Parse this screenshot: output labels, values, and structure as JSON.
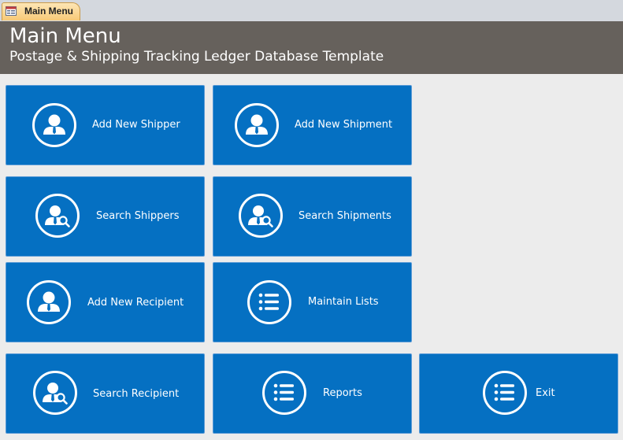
{
  "tab": {
    "label": "Main Menu",
    "icon": "form-icon"
  },
  "header": {
    "title": "Main Menu",
    "subtitle": "Postage & Shipping Tracking Ledger Database Template"
  },
  "buttons": {
    "add_new_shipper": {
      "label": "Add New Shipper",
      "icon": "user-icon"
    },
    "add_new_shipment": {
      "label": "Add New Shipment",
      "icon": "user-icon"
    },
    "search_shippers": {
      "label": "Search Shippers",
      "icon": "user-search-icon"
    },
    "search_shipments": {
      "label": "Search Shipments",
      "icon": "user-search-icon"
    },
    "add_new_recipient": {
      "label": "Add New Recipient",
      "icon": "user-icon"
    },
    "maintain_lists": {
      "label": "Maintain Lists",
      "icon": "list-icon"
    },
    "search_recipient": {
      "label": "Search Recipient",
      "icon": "user-search-icon"
    },
    "reports": {
      "label": "Reports",
      "icon": "list-icon"
    },
    "exit": {
      "label": "Exit",
      "icon": "list-icon"
    }
  },
  "colors": {
    "button_blue": "#0570c2",
    "header_gray": "#66615c",
    "background": "#ececec"
  }
}
